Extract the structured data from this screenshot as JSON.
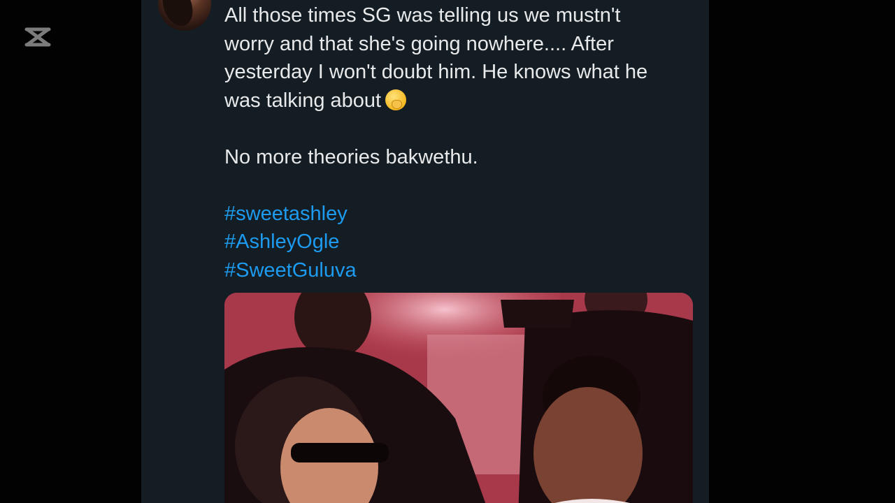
{
  "watermark": {
    "icon": "capcut-logo-icon"
  },
  "tweet": {
    "avatar_icon": "profile-avatar",
    "lines": [
      "All those times SG was telling us we mustn't",
      "worry and that she's going nowhere.... After",
      "yesterday I won't doubt him. He knows what he",
      "was talking about"
    ],
    "emoji": "face-with-hand-over-mouth",
    "paragraph2": "No more theories bakwethu.",
    "hashtags": [
      "#sweetashley",
      "#AshleyOgle",
      "#SweetGuluva"
    ],
    "colors": {
      "background": "#151d24",
      "text": "#e7e9ea",
      "hashtag": "#1d9bf0"
    }
  }
}
